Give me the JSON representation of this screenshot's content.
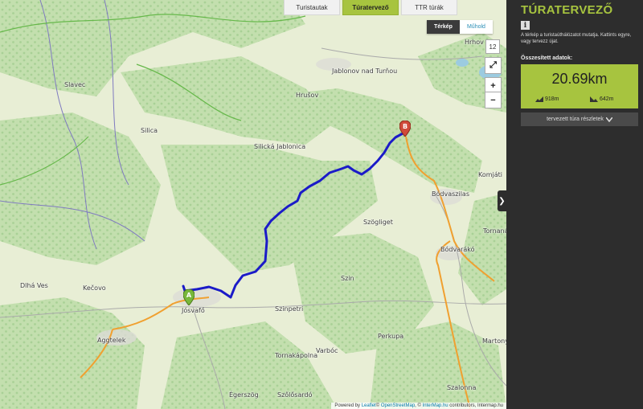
{
  "tabs": [
    "Turistautak",
    "Túratervező",
    "TTR túrák"
  ],
  "active_tab": "Túratervező",
  "layer_switch": {
    "map": "Térkép",
    "satellite": "Műhold"
  },
  "zoom_level": "12",
  "controls": {
    "fullscreen": "⤢",
    "zoom_in": "+",
    "zoom_out": "−"
  },
  "places": [
    "Hrhov",
    "Jablonov nad Turňou",
    "Slavec",
    "Hrušov",
    "Silica",
    "Silická Jablonica",
    "Komjáti",
    "Bódvaszilas",
    "Szögliget",
    "Tornanádaska",
    "Bódvarákó",
    "Dlhá Ves",
    "Kečovo",
    "Szin",
    "Jósvafő",
    "Szinpetri",
    "Aggtelek",
    "Perkupa",
    "Tornakápolna",
    "Varbóc",
    "Martonyi",
    "Szalonna",
    "Égerszög",
    "Szőlősardó"
  ],
  "markers": {
    "start": "A",
    "end": "B"
  },
  "attribution": {
    "prefix": "Powered by",
    "leaflet": "Leaflet",
    "osm": "OpenStreetMap",
    "intermap": "InterMap.hu",
    "suffix": "contributors, Intermap.hu",
    "osm_prefix": "© ",
    "mid": ", © "
  },
  "panel": {
    "title": "TÚRATERVEZŐ",
    "info_icon": "i",
    "description": "A térkép a turistaúthálózatot mutatja. Kattints egyre, vagy tervezz újat.",
    "summary_label": "Összesített adatok:",
    "distance": "20.69km",
    "ascent": "918m",
    "descent": "642m",
    "details_button": "tervezett túra részletek"
  },
  "colors": {
    "accent": "#a7c43f",
    "route": "#1b1bc8",
    "trail": "#f0a030",
    "panel_bg": "#2d2d2d"
  }
}
